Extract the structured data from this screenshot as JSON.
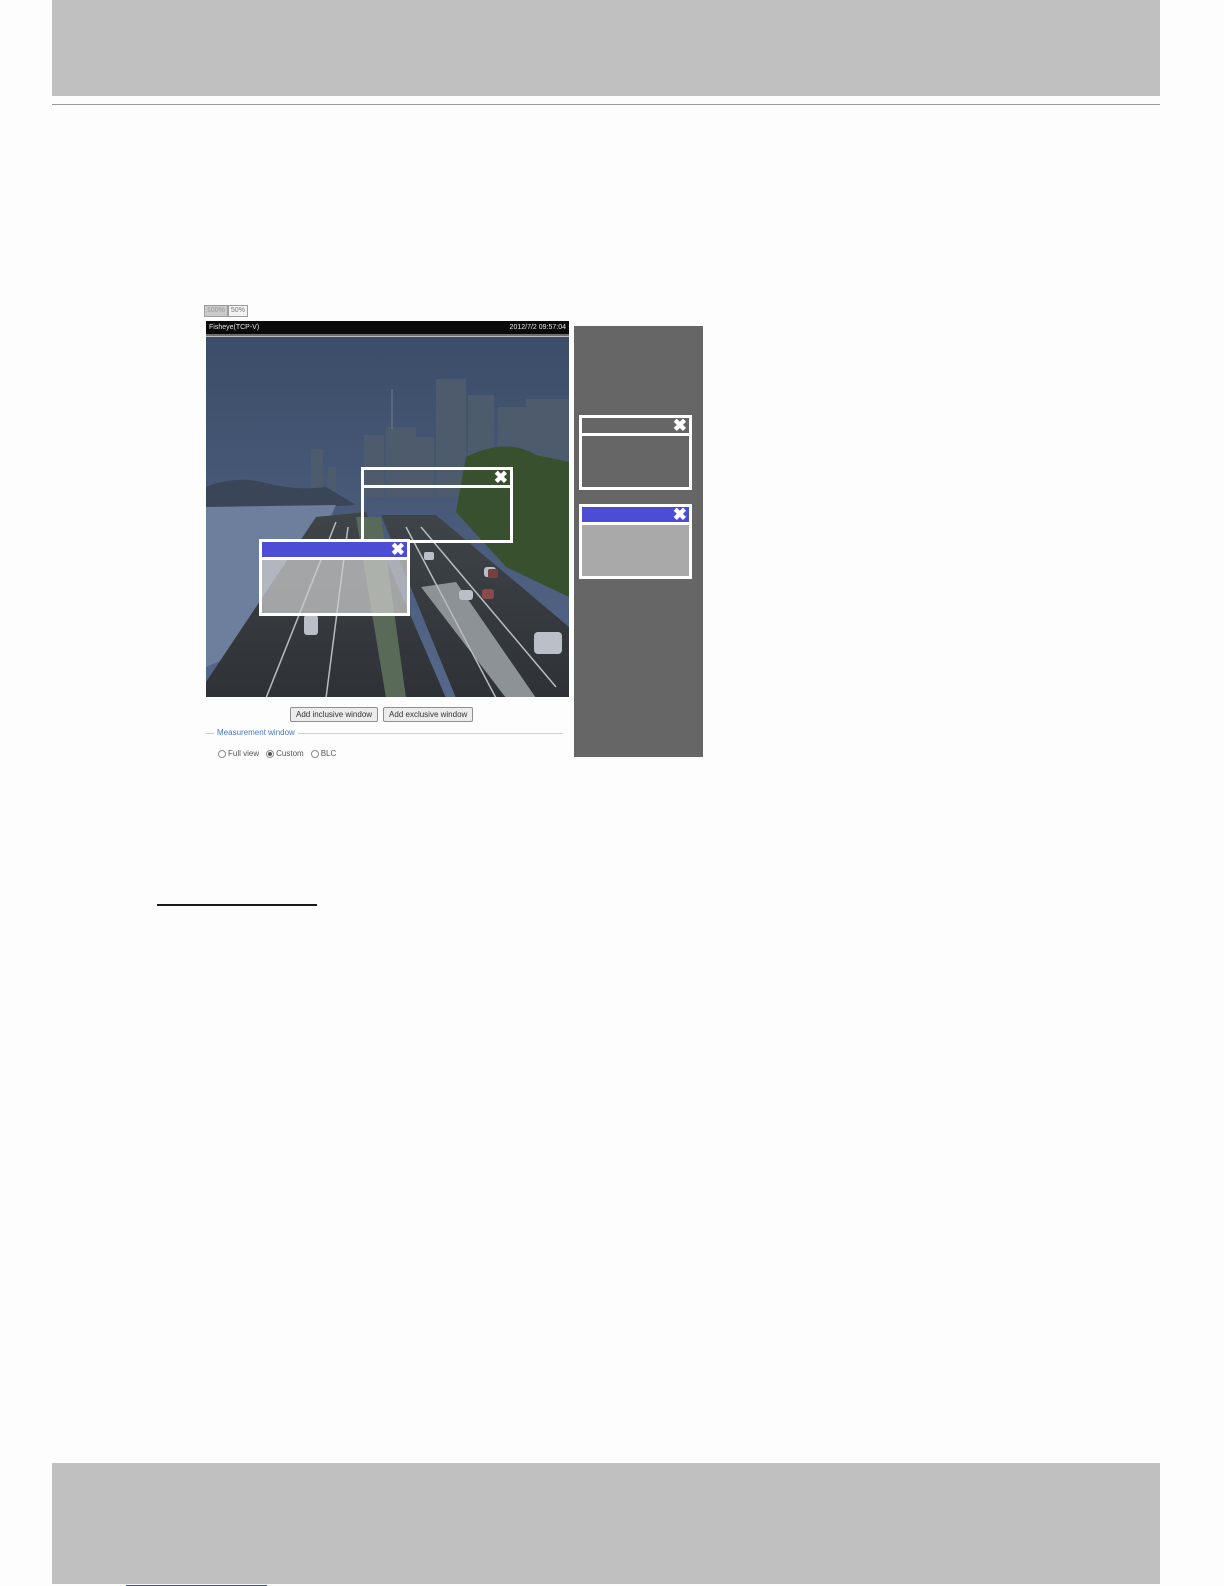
{
  "viewer": {
    "size_buttons": [
      "100%",
      "50%"
    ],
    "video_title": {
      "source": "Fisheye(TCP-V)",
      "timestamp": "2012/7/2 09:57:04"
    },
    "windows": [
      {
        "type": "inclusive",
        "close_glyph": "✖"
      },
      {
        "type": "exclusive",
        "close_glyph": "✖"
      }
    ]
  },
  "actions": {
    "add_inclusive": "Add inclusive window",
    "add_exclusive": "Add exclusive window"
  },
  "measurement": {
    "title": "Measurement window",
    "options": [
      "Full view",
      "Custom",
      "BLC"
    ],
    "selected": "Custom"
  },
  "legend": {
    "inclusive_close_glyph": "✖",
    "exclusive_close_glyph": "✖"
  },
  "colors": {
    "exclusive_bar": "#4b4dd4",
    "window_border": "#ffffff",
    "legend_background": "#666666",
    "page_chrome": "#c0c0c0"
  }
}
